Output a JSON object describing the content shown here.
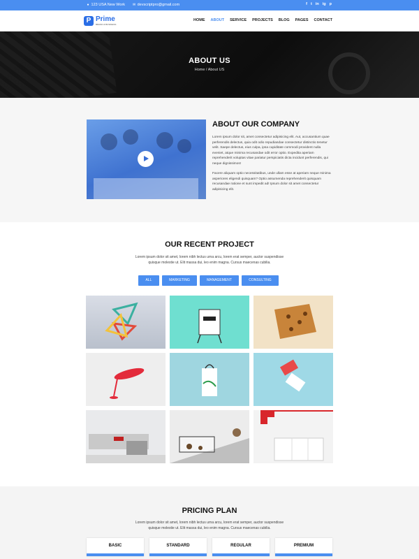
{
  "topbar": {
    "address": "123 USA New Work",
    "email": "devscriptpro@gmail.com",
    "social": [
      "f",
      "t",
      "in",
      "ig",
      "p"
    ]
  },
  "nav": {
    "logo_name": "Prime",
    "logo_tagline": "BRAND & BUSINESS",
    "items": [
      "HOME",
      "ABOUT",
      "SERVICE",
      "PROJECTS",
      "BLOG",
      "PAGES",
      "CONTACT"
    ]
  },
  "hero": {
    "title": "ABOUT US",
    "breadcrumb_home": "Home /",
    "breadcrumb_current": "About US"
  },
  "about": {
    "title": "ABOUT OUR COMPANY",
    "para1": "Lorem ipsum dolor sit, amet consectetur adipisicing elit. Aut, accusantium quae perferendis delectus, quia odit odio repudiandae consectetur distinctio tenetur velit. Saepe delectus, eius culpa, ipsa cupiditate commodi provident nulla eveniet, atque minima recusandae odit error optio. Expedita aperiam reprehenderit voluptas vitae pariatur perspiciatis dicta incidunt perferendis, qui neque dignissimos!",
    "para2": "Facere aliquam optio necessitatibus, unde ullam esse at aperiam neque minima asperiores eligendi quisquam? Optio assumenda reprehenderit quisquam recusandae ratione et sunt impedit ad! Ipsum dolor sit amet consectetur adipisicing elit."
  },
  "projects": {
    "title": "OUR RECENT PROJECT",
    "subtitle": "Lorem ipsum dolor sit amet, lorem nibh lectus urna arcu, lorem erat semper, auctor suspendisse quisque molestie ut. Elit massa dui, leo enim magna. Cursus maecenas cubilia.",
    "filters": [
      "ALL",
      "MARKETING",
      "MANAGEMENT",
      "CONSULTING"
    ]
  },
  "pricing": {
    "title": "PRICING PLAN",
    "subtitle": "Lorem ipsum dolor sit amet, lorem nibh lectus urna arcu, lorem erat semper, auctor suspendisse quisque molestie ut. Elit massa dui, leo enim magna. Cursus maecenas cubilia.",
    "plans": [
      "BASIC",
      "STANDARD",
      "REGULAR",
      "PREMIUM"
    ]
  },
  "colors": {
    "accent": "#4a8ef0",
    "dark_hero": "#111111"
  }
}
